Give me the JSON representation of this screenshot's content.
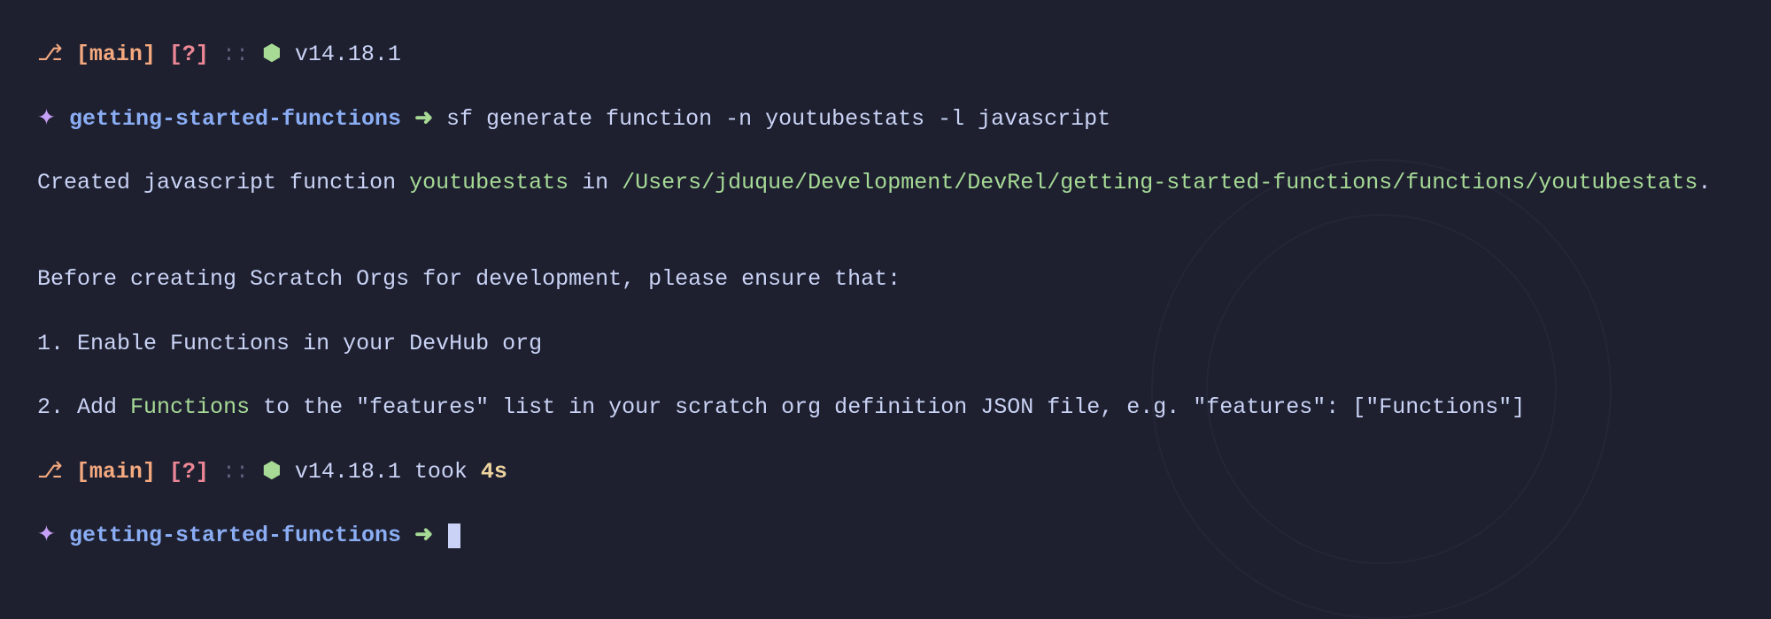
{
  "prompt1": {
    "branch_icon": "⎇",
    "branch_lb": "[",
    "branch": "main",
    "branch_rb": "]",
    "status": "[?]",
    "sep": "::",
    "hex": "⬢",
    "version": "v14.18.1",
    "sparkle": "✦",
    "project": "getting-started-functions",
    "arrow": "➜",
    "command": "sf generate function -n youtubestats -l javascript"
  },
  "output": {
    "created_prefix": "Created javascript function ",
    "fn_name": "youtubestats",
    "created_mid": " in ",
    "path": "/Users/jduque/Development/DevRel/getting-started-functions/functions/youtubestats",
    "period": ".",
    "before_line": "Before creating Scratch Orgs for development, please ensure that:",
    "step1": "1. Enable Functions in your DevHub org",
    "step2_prefix": "2. Add ",
    "step2_highlight": "Functions",
    "step2_suffix": " to the \"features\" list in your scratch org definition JSON file, e.g. \"features\": [\"Functions\"]"
  },
  "prompt2": {
    "branch_icon": "⎇",
    "branch_lb": "[",
    "branch": "main",
    "branch_rb": "]",
    "status": "[?]",
    "sep": "::",
    "hex": "⬢",
    "version": "v14.18.1",
    "took_label": "took",
    "took_time": "4s",
    "sparkle": "✦",
    "project": "getting-started-functions",
    "arrow": "➜"
  }
}
